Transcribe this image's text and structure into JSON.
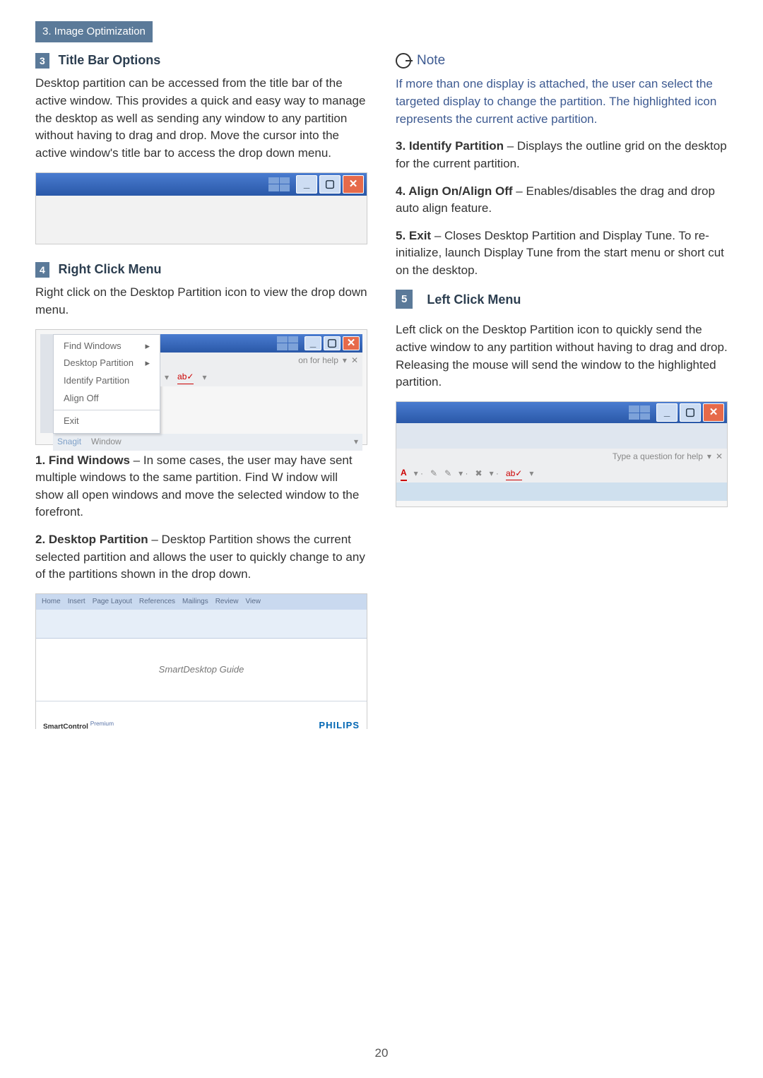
{
  "header": {
    "section_tab": "3. Image Optimization"
  },
  "left": {
    "s3_num": "3",
    "s3_title": "Title Bar Options",
    "s3_body": "Desktop partition can be accessed from the title bar of the active window. This provides a quick and easy way to manage the desktop as well as sending any window to any partition without having to drag and drop.  Move the cursor into the active window's title bar to access the drop down menu.",
    "s4_num": "4",
    "s4_title": "Right Click Menu",
    "s4_body": "Right click on the Desktop Partition icon to view the drop down menu.",
    "ctx": {
      "find": "Find Windows",
      "dp": "Desktop Partition",
      "ident": "Identify Partition",
      "align": "Align Off",
      "exit": "Exit",
      "snag": "Snagit",
      "win": "Window",
      "help": "on for help"
    },
    "i1_head": "1. Find Windows",
    "i1_body": " – In some cases, the user may  have sent multiple windows to the same partition.  Find W indow will show all open windows and move the selected window to the forefront.",
    "i2_head": "2. Desktop Partition",
    "i2_body": " – Desktop Partition shows the current selected partition and allows the user to quickly change to any of the partitions shown in the drop down.",
    "word": {
      "title": "SmartDesktop Guide",
      "brand": "SmartControl",
      "sup": "Premium",
      "philips": "PHILIPS"
    }
  },
  "right": {
    "note_title": "Note",
    "note_body": "If more than one display is attached, the user can select the targeted display to change the partition. The highlighted icon represents the current active partition.",
    "i3_head": "3. Identify Partition",
    "i3_body": " – Displays the outline grid on the desktop for the current partition.",
    "i4_head": "4. Align On/Align Off",
    "i4_body": " – Enables/disables the drag and drop auto align feature.",
    "i5_head": "5. Exit",
    "i5_body": " – Closes Desktop Partition and  Display Tune.  To re-initialize, launch  Display Tune from the start menu or short cut   on the desktop.",
    "s5_num": "5",
    "s5_title": "Left Click Menu",
    "s5_body": "Left click on the Desktop Partition icon to quickly send the active window to any partition without having to drag and drop. Releasing the mouse will send the window to the highlighted partition.",
    "help2": "Type a question for help"
  },
  "page_number": "20"
}
